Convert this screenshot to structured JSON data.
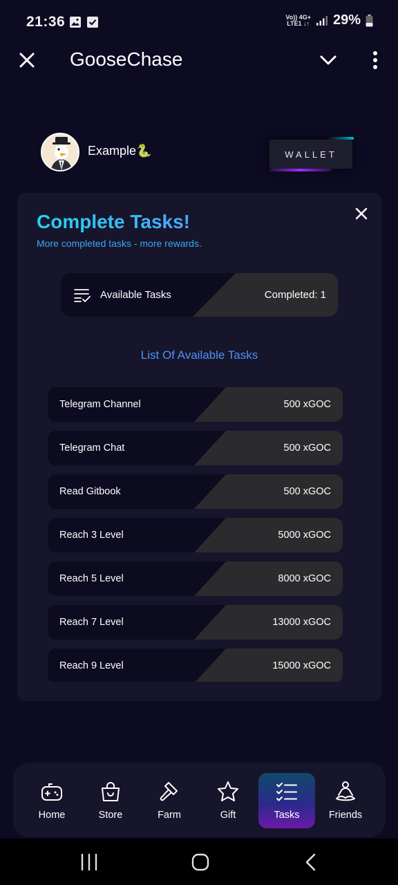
{
  "status_bar": {
    "time": "21:36",
    "network_top": "Vo)) 4G+",
    "network_bottom": "LTE1 ↓↑",
    "battery": "29%"
  },
  "header": {
    "title": "GooseChase"
  },
  "profile": {
    "username": "Example🐍",
    "wallet_label": "WALLET"
  },
  "card": {
    "title": "Complete Tasks!",
    "subtitle": "More completed tasks - more rewards.",
    "summary_label": "Available Tasks",
    "summary_completed": "Completed: 1",
    "list_title": "List Of Available Tasks"
  },
  "tasks": [
    {
      "name": "Telegram Channel",
      "reward": "500 xGOC"
    },
    {
      "name": "Telegram Chat",
      "reward": "500 xGOC"
    },
    {
      "name": "Read Gitbook",
      "reward": "500 xGOC"
    },
    {
      "name": "Reach 3 Level",
      "reward": "5000 xGOC"
    },
    {
      "name": "Reach 5 Level",
      "reward": "8000 xGOC"
    },
    {
      "name": "Reach 7 Level",
      "reward": "13000 xGOC"
    },
    {
      "name": "Reach 9 Level",
      "reward": "15000 xGOC"
    }
  ],
  "nav": {
    "items": [
      {
        "label": "Home",
        "icon": "gamepad-icon"
      },
      {
        "label": "Store",
        "icon": "shopping-bag-icon"
      },
      {
        "label": "Farm",
        "icon": "hammer-icon"
      },
      {
        "label": "Gift",
        "icon": "star-icon"
      },
      {
        "label": "Tasks",
        "icon": "checklist-icon"
      },
      {
        "label": "Friends",
        "icon": "meditation-icon"
      }
    ],
    "active": "Tasks"
  },
  "colors": {
    "background": "#0c0b22",
    "card": "#16152b",
    "accent_cyan": "#23d3ef",
    "accent_blue": "#4d92f5",
    "accent_purple": "#a229ff"
  }
}
